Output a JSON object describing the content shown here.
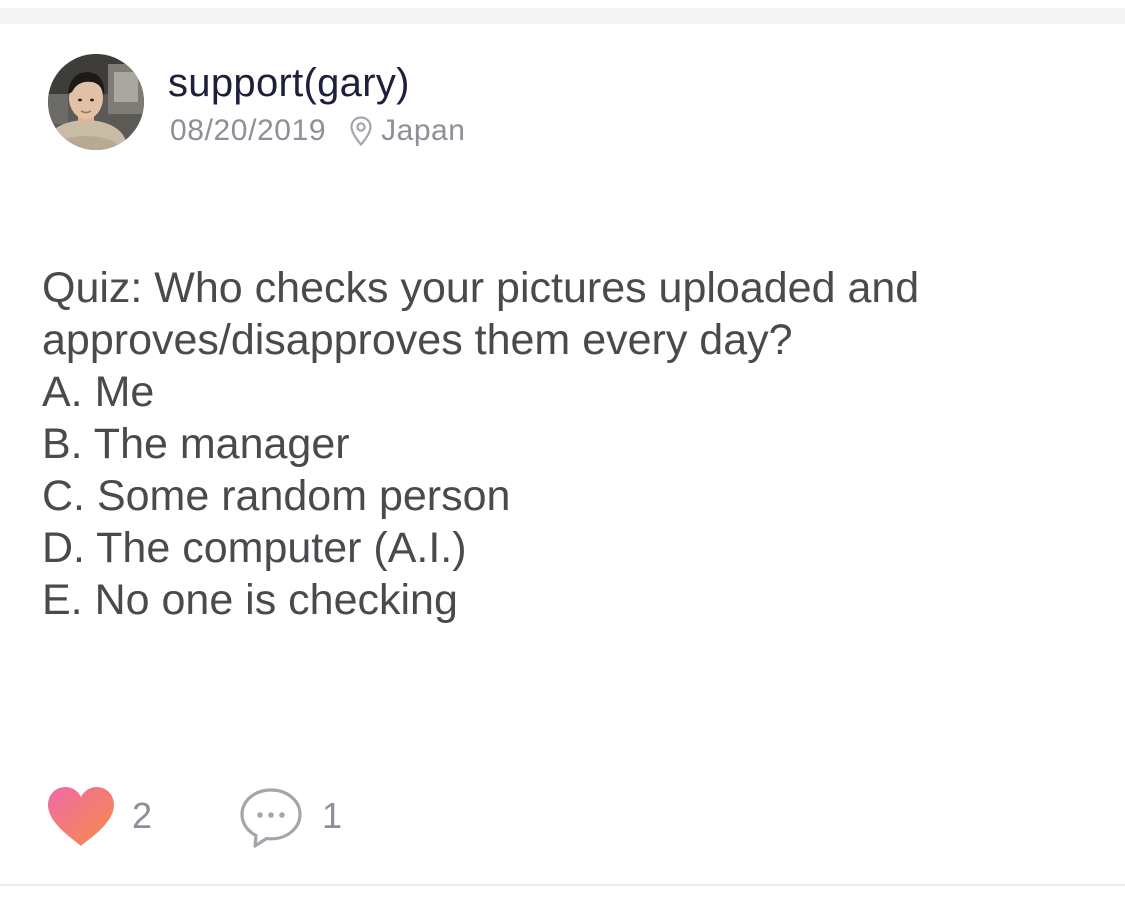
{
  "post": {
    "author": {
      "name": "support(gary)",
      "avatar_icon": "user-avatar-photo"
    },
    "date": "08/20/2019",
    "location_icon": "location-pin-icon",
    "location": "Japan",
    "body_lines": [
      "Quiz: Who checks your pictures uploaded and",
      "approves/disapproves them every day?",
      "A. Me",
      "B. The manager",
      "C. Some random person",
      "D. The computer (A.I.)",
      "E. No one is checking"
    ],
    "actions": {
      "like_icon": "heart-icon",
      "like_count": "2",
      "comment_icon": "comment-bubble-icon",
      "comment_count": "1"
    }
  },
  "colors": {
    "author_name": "#1e1f3a",
    "meta": "#8d8f99",
    "body_text": "#4a4a4e",
    "heart_gradient_start": "#f26d9e",
    "heart_gradient_end": "#f58a4b"
  }
}
